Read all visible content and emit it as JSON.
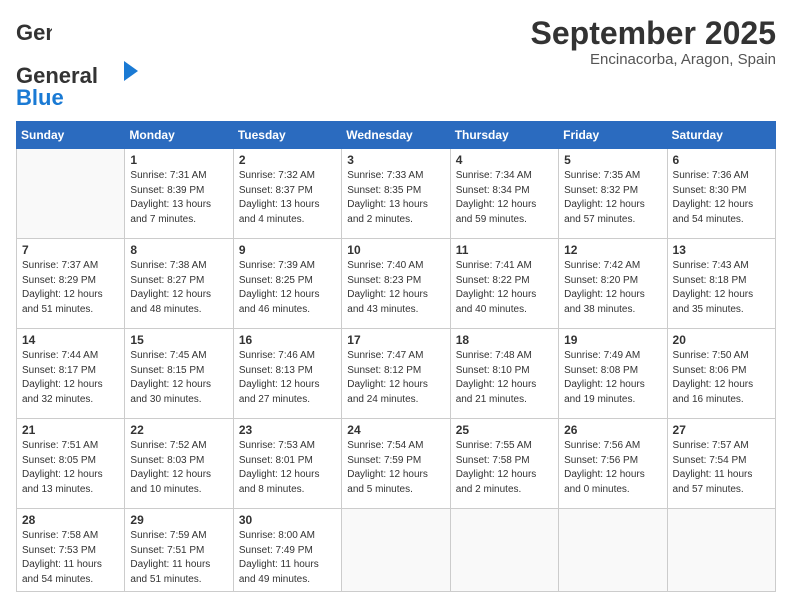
{
  "header": {
    "logo_general": "General",
    "logo_blue": "Blue",
    "month_title": "September 2025",
    "location": "Encinacorba, Aragon, Spain"
  },
  "weekdays": [
    "Sunday",
    "Monday",
    "Tuesday",
    "Wednesday",
    "Thursday",
    "Friday",
    "Saturday"
  ],
  "weeks": [
    [
      {
        "day": "",
        "sunrise": "",
        "sunset": "",
        "daylight": ""
      },
      {
        "day": "1",
        "sunrise": "Sunrise: 7:31 AM",
        "sunset": "Sunset: 8:39 PM",
        "daylight": "Daylight: 13 hours and 7 minutes."
      },
      {
        "day": "2",
        "sunrise": "Sunrise: 7:32 AM",
        "sunset": "Sunset: 8:37 PM",
        "daylight": "Daylight: 13 hours and 4 minutes."
      },
      {
        "day": "3",
        "sunrise": "Sunrise: 7:33 AM",
        "sunset": "Sunset: 8:35 PM",
        "daylight": "Daylight: 13 hours and 2 minutes."
      },
      {
        "day": "4",
        "sunrise": "Sunrise: 7:34 AM",
        "sunset": "Sunset: 8:34 PM",
        "daylight": "Daylight: 12 hours and 59 minutes."
      },
      {
        "day": "5",
        "sunrise": "Sunrise: 7:35 AM",
        "sunset": "Sunset: 8:32 PM",
        "daylight": "Daylight: 12 hours and 57 minutes."
      },
      {
        "day": "6",
        "sunrise": "Sunrise: 7:36 AM",
        "sunset": "Sunset: 8:30 PM",
        "daylight": "Daylight: 12 hours and 54 minutes."
      }
    ],
    [
      {
        "day": "7",
        "sunrise": "Sunrise: 7:37 AM",
        "sunset": "Sunset: 8:29 PM",
        "daylight": "Daylight: 12 hours and 51 minutes."
      },
      {
        "day": "8",
        "sunrise": "Sunrise: 7:38 AM",
        "sunset": "Sunset: 8:27 PM",
        "daylight": "Daylight: 12 hours and 48 minutes."
      },
      {
        "day": "9",
        "sunrise": "Sunrise: 7:39 AM",
        "sunset": "Sunset: 8:25 PM",
        "daylight": "Daylight: 12 hours and 46 minutes."
      },
      {
        "day": "10",
        "sunrise": "Sunrise: 7:40 AM",
        "sunset": "Sunset: 8:23 PM",
        "daylight": "Daylight: 12 hours and 43 minutes."
      },
      {
        "day": "11",
        "sunrise": "Sunrise: 7:41 AM",
        "sunset": "Sunset: 8:22 PM",
        "daylight": "Daylight: 12 hours and 40 minutes."
      },
      {
        "day": "12",
        "sunrise": "Sunrise: 7:42 AM",
        "sunset": "Sunset: 8:20 PM",
        "daylight": "Daylight: 12 hours and 38 minutes."
      },
      {
        "day": "13",
        "sunrise": "Sunrise: 7:43 AM",
        "sunset": "Sunset: 8:18 PM",
        "daylight": "Daylight: 12 hours and 35 minutes."
      }
    ],
    [
      {
        "day": "14",
        "sunrise": "Sunrise: 7:44 AM",
        "sunset": "Sunset: 8:17 PM",
        "daylight": "Daylight: 12 hours and 32 minutes."
      },
      {
        "day": "15",
        "sunrise": "Sunrise: 7:45 AM",
        "sunset": "Sunset: 8:15 PM",
        "daylight": "Daylight: 12 hours and 30 minutes."
      },
      {
        "day": "16",
        "sunrise": "Sunrise: 7:46 AM",
        "sunset": "Sunset: 8:13 PM",
        "daylight": "Daylight: 12 hours and 27 minutes."
      },
      {
        "day": "17",
        "sunrise": "Sunrise: 7:47 AM",
        "sunset": "Sunset: 8:12 PM",
        "daylight": "Daylight: 12 hours and 24 minutes."
      },
      {
        "day": "18",
        "sunrise": "Sunrise: 7:48 AM",
        "sunset": "Sunset: 8:10 PM",
        "daylight": "Daylight: 12 hours and 21 minutes."
      },
      {
        "day": "19",
        "sunrise": "Sunrise: 7:49 AM",
        "sunset": "Sunset: 8:08 PM",
        "daylight": "Daylight: 12 hours and 19 minutes."
      },
      {
        "day": "20",
        "sunrise": "Sunrise: 7:50 AM",
        "sunset": "Sunset: 8:06 PM",
        "daylight": "Daylight: 12 hours and 16 minutes."
      }
    ],
    [
      {
        "day": "21",
        "sunrise": "Sunrise: 7:51 AM",
        "sunset": "Sunset: 8:05 PM",
        "daylight": "Daylight: 12 hours and 13 minutes."
      },
      {
        "day": "22",
        "sunrise": "Sunrise: 7:52 AM",
        "sunset": "Sunset: 8:03 PM",
        "daylight": "Daylight: 12 hours and 10 minutes."
      },
      {
        "day": "23",
        "sunrise": "Sunrise: 7:53 AM",
        "sunset": "Sunset: 8:01 PM",
        "daylight": "Daylight: 12 hours and 8 minutes."
      },
      {
        "day": "24",
        "sunrise": "Sunrise: 7:54 AM",
        "sunset": "Sunset: 7:59 PM",
        "daylight": "Daylight: 12 hours and 5 minutes."
      },
      {
        "day": "25",
        "sunrise": "Sunrise: 7:55 AM",
        "sunset": "Sunset: 7:58 PM",
        "daylight": "Daylight: 12 hours and 2 minutes."
      },
      {
        "day": "26",
        "sunrise": "Sunrise: 7:56 AM",
        "sunset": "Sunset: 7:56 PM",
        "daylight": "Daylight: 12 hours and 0 minutes."
      },
      {
        "day": "27",
        "sunrise": "Sunrise: 7:57 AM",
        "sunset": "Sunset: 7:54 PM",
        "daylight": "Daylight: 11 hours and 57 minutes."
      }
    ],
    [
      {
        "day": "28",
        "sunrise": "Sunrise: 7:58 AM",
        "sunset": "Sunset: 7:53 PM",
        "daylight": "Daylight: 11 hours and 54 minutes."
      },
      {
        "day": "29",
        "sunrise": "Sunrise: 7:59 AM",
        "sunset": "Sunset: 7:51 PM",
        "daylight": "Daylight: 11 hours and 51 minutes."
      },
      {
        "day": "30",
        "sunrise": "Sunrise: 8:00 AM",
        "sunset": "Sunset: 7:49 PM",
        "daylight": "Daylight: 11 hours and 49 minutes."
      },
      {
        "day": "",
        "sunrise": "",
        "sunset": "",
        "daylight": ""
      },
      {
        "day": "",
        "sunrise": "",
        "sunset": "",
        "daylight": ""
      },
      {
        "day": "",
        "sunrise": "",
        "sunset": "",
        "daylight": ""
      },
      {
        "day": "",
        "sunrise": "",
        "sunset": "",
        "daylight": ""
      }
    ]
  ]
}
